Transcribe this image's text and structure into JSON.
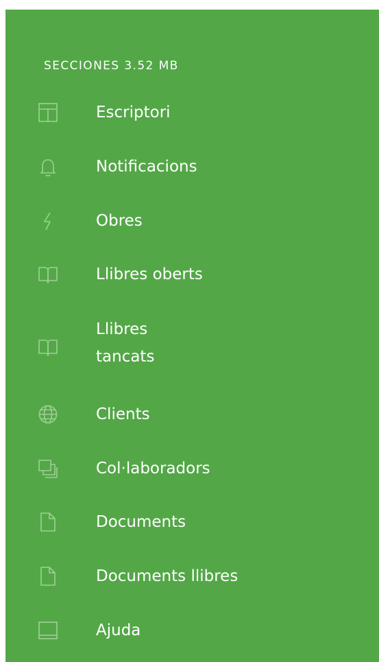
{
  "sidebar": {
    "background_color": "#53a747",
    "header": "SECCIONES 3.52 MB",
    "items": [
      {
        "label": "Escriptori",
        "icon": "layout-icon"
      },
      {
        "label": "Notificacions",
        "icon": "bell-icon"
      },
      {
        "label": "Obres",
        "icon": "lightning-icon"
      },
      {
        "label": "Llibres oberts",
        "icon": "open-book-icon"
      },
      {
        "label": "Llibres tancats",
        "icon": "closed-book-icon"
      },
      {
        "label": "Clients",
        "icon": "globe-icon"
      },
      {
        "label": "Col·laboradors",
        "icon": "copy-icon"
      },
      {
        "label": "Documents",
        "icon": "document-icon"
      },
      {
        "label": "Documents llibres",
        "icon": "document-icon"
      },
      {
        "label": "Ajuda",
        "icon": "monitor-icon"
      }
    ]
  }
}
